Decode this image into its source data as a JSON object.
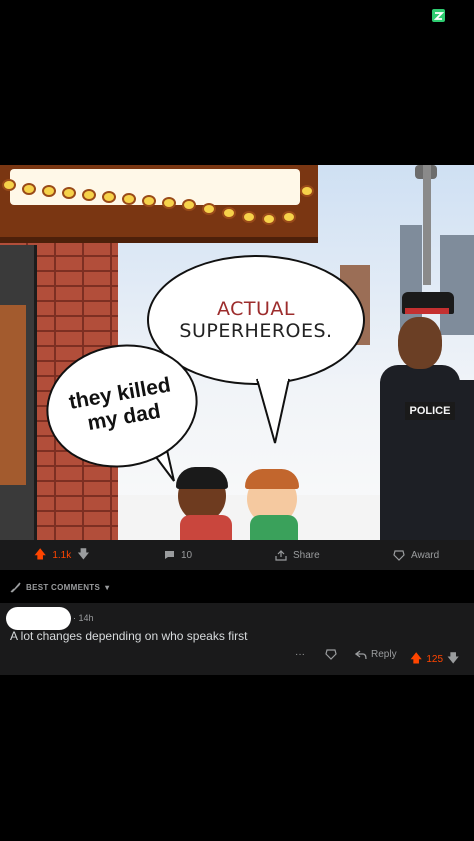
{
  "post": {
    "image": {
      "bubble_top_line1": "ACTUAL",
      "bubble_top_line2": "SUPERHEROES.",
      "bubble_left": "they killed my dad",
      "police_label": "POLICE"
    },
    "actions": {
      "votes": "1.1k",
      "comments": "10",
      "share": "Share",
      "award": "Award"
    }
  },
  "comments_header": {
    "sort_label": "BEST COMMENTS"
  },
  "comment": {
    "meta": "· 14h",
    "body": "A lot changes depending on who speaks first",
    "more": "···",
    "reply": "Reply",
    "votes": "125"
  },
  "colors": {
    "upvote": "#ff4500",
    "bg": "#000000",
    "panel": "#1a1a1b",
    "status_icon": "#2ecc71"
  }
}
